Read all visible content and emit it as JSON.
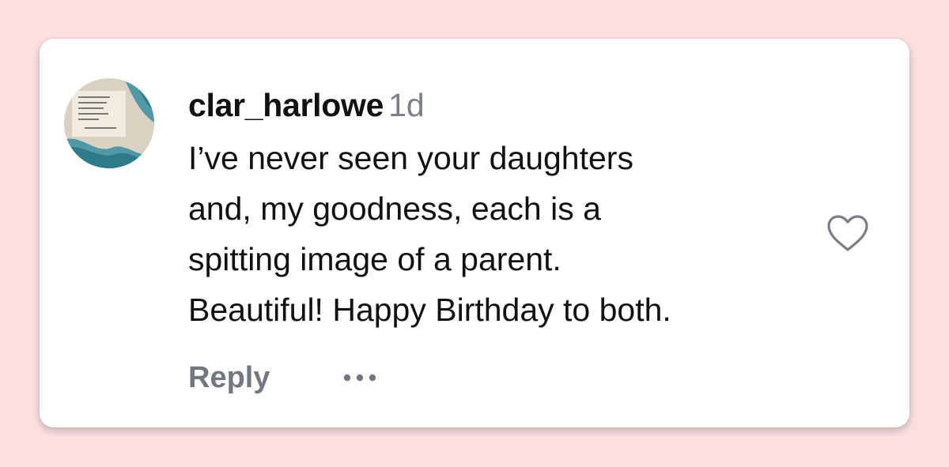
{
  "comment": {
    "username": "clar_harlowe",
    "timestamp": "1d",
    "lines": [
      "I’ve never seen your daughters",
      "and, my goodness, each is a",
      "spitting image of a parent.",
      "Beautiful! Happy Birthday to both."
    ],
    "reply_label": "Reply"
  },
  "icons": {
    "like": "heart-outline-icon",
    "more": "more-horizontal-icon"
  },
  "colors": {
    "background": "#fbdfe1",
    "card": "#ffffff",
    "text": "#111111",
    "muted": "#737780",
    "avatar_accent": "#3a8fa0"
  }
}
